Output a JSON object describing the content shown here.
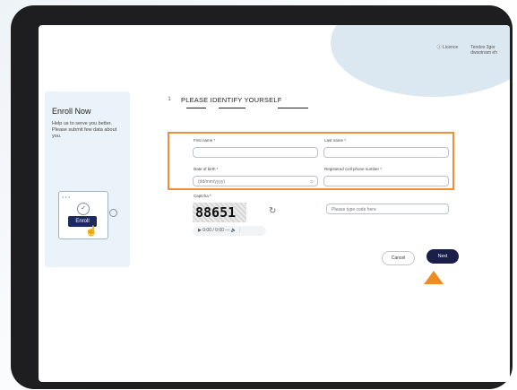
{
  "header": {
    "link_left": "ⓘ Licence",
    "link_right": "Tendes 3gor\ndwsotnam eh"
  },
  "enroll": {
    "title": "Enroll Now",
    "description": "Help us to serve you better. Please submit few data about you.",
    "button_label": "Enroll"
  },
  "form": {
    "step_number": "1",
    "step_title": "PLEASE IDENTIFY YOURSELF",
    "first_name_label": "First name *",
    "last_name_label": "Last name *",
    "dob_label": "Date of birth *",
    "dob_placeholder": "(dd/mm/yyyy)",
    "phone_label": "Registered Cell phone number *",
    "captcha_label": "Captcha *",
    "captcha_value": "88651",
    "captcha_placeholder": "Please type code here",
    "audio_time": "0:00 / 0:00",
    "cancel_label": "Cancel",
    "next_label": "Next"
  },
  "colors": {
    "highlight": "#ef8f3c",
    "arrow": "#f08c24",
    "next_bg": "#1a1f4a",
    "tablet_frame": "#1e1e20"
  }
}
